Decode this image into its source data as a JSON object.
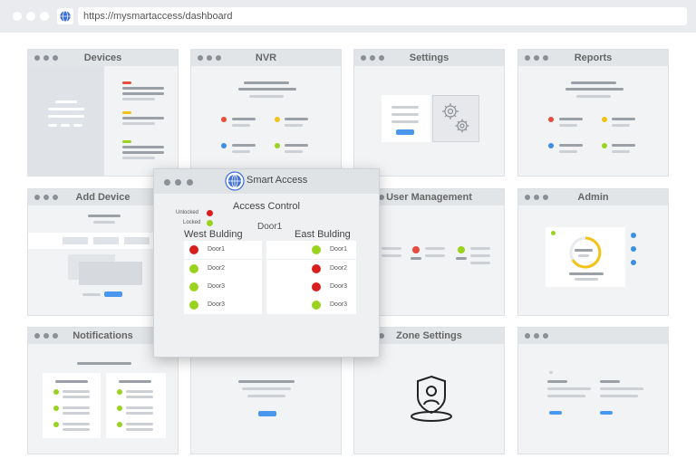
{
  "browser": {
    "url": "https://mysmartaccess/dashboard"
  },
  "cards": {
    "devices": "Devices",
    "nvr": "NVR",
    "settings": "Settings",
    "reports": "Reports",
    "add_device": "Add Device",
    "user_management": "User Management",
    "admin": "Admin",
    "notifications": "Notifications",
    "zone_settings": "Zone Settings"
  },
  "popup": {
    "app_title": "Smart Access",
    "section_title": "Access Control",
    "legend": {
      "unlocked": "Unlocked",
      "locked": "Locked"
    },
    "door_header": "Door1",
    "west": {
      "title": "West Bulding",
      "rows": [
        {
          "label": "Door1",
          "status": "unlocked"
        },
        {
          "label": "Door2",
          "status": "locked"
        },
        {
          "label": "Door3",
          "status": "locked"
        },
        {
          "label": "Door3",
          "status": "locked"
        }
      ]
    },
    "east": {
      "title": "East Bulding",
      "rows": [
        {
          "label": "Door1",
          "status": "locked"
        },
        {
          "label": "Door2",
          "status": "unlocked"
        },
        {
          "label": "Door3",
          "status": "unlocked"
        },
        {
          "label": "Door3",
          "status": "locked"
        }
      ]
    }
  },
  "colors": {
    "unlocked": "#d91e1e",
    "locked": "#9ad31e",
    "accent_blue": "#4a97f0",
    "chrome": "#e9ebee"
  }
}
